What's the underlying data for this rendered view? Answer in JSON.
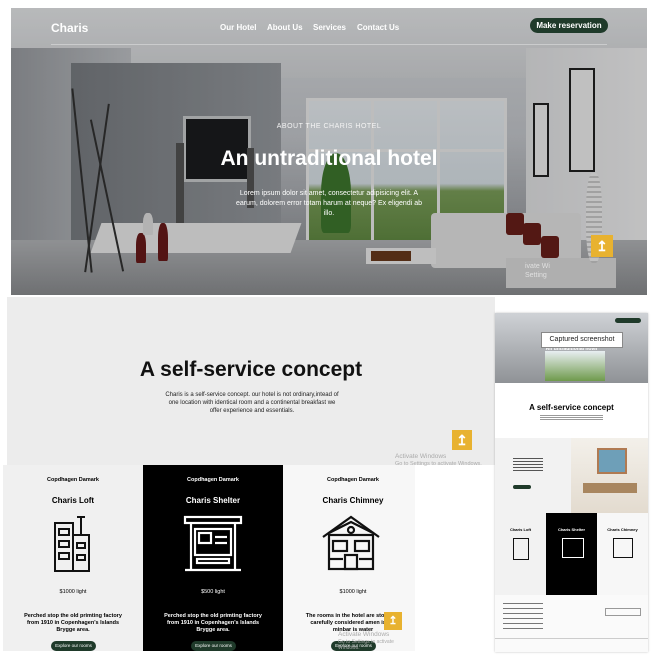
{
  "header": {
    "logo": "Charis",
    "nav": [
      "Our Hotel",
      "About Us",
      "Services",
      "Contact Us"
    ],
    "reserve_button": "Make reservation"
  },
  "hero": {
    "kicker": "ABOUT THE CHARIS HOTEL",
    "title": "An untraditional hotel",
    "body": "Lorem ipsum dolor sit amet, consectetur adipisicing elit. A earum, dolorem error totam harum at neque? Ex eligendi ab illo.",
    "watermark": "ivate Wi\nSetting"
  },
  "concept": {
    "title": "A self-service concept",
    "body": "Charis is a self-service concept. our hotel is not ordinary,intead of one location with identical room and a continental breakfast we offer experience and essentials.",
    "activate_line1": "Activate Windows",
    "activate_line2": "Go to Settings to activate Windows."
  },
  "cards": [
    {
      "tag": "Copdhagen Damark",
      "title": "Charis Loft",
      "price": "$1000 light",
      "body": "Perched stop the old primting factory from 1910 in Copenhagen's Islands Brygge area.",
      "button": "Explore our rooms",
      "icon": "building-icon"
    },
    {
      "tag": "Copdhagen Damark",
      "title": "Charis Shelter",
      "price": "$500 light",
      "body": "Perched stop the old primting factory from 1910 in Copenhagen's Islands Brygge area.",
      "button": "Explore our rooms",
      "icon": "bus-shelter-icon"
    },
    {
      "tag": "Copdhagen Damark",
      "title": "Charis Chimney",
      "price": "$1000 light",
      "body": "The rooms in the hotel are stop with carefully considered amen is the minbar is water",
      "button": "Explore our rooms",
      "icon": "house-icon"
    }
  ],
  "cards_watermark": {
    "line1": "Activate Windows",
    "line2": "Go to Settings to activate Windows."
  },
  "thumbnail": {
    "tooltip": "Captured screenshot",
    "title": "A self-service concept",
    "hero_title": "An untraditional hotel",
    "cards": [
      "Charis Loft",
      "Charis Shelter",
      "Charis Chimney"
    ]
  },
  "colors": {
    "accent": "#1f3a2a",
    "scroll_top": "#e8b230",
    "dark_card": "#000000"
  }
}
